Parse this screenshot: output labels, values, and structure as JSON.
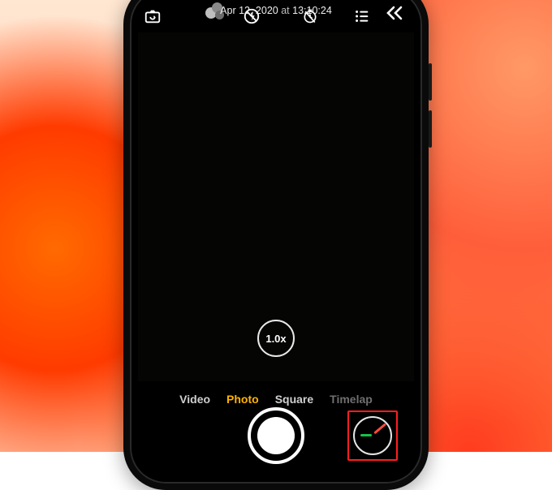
{
  "timestamp": {
    "date": "Apr 12, 2020",
    "at": "at",
    "time": "13:10:24"
  },
  "zoom": {
    "level": "1.0x"
  },
  "modes": {
    "items": [
      {
        "label": "Video"
      },
      {
        "label": "Photo"
      },
      {
        "label": "Square"
      },
      {
        "label": "Timelap"
      }
    ],
    "active_index": 1
  }
}
